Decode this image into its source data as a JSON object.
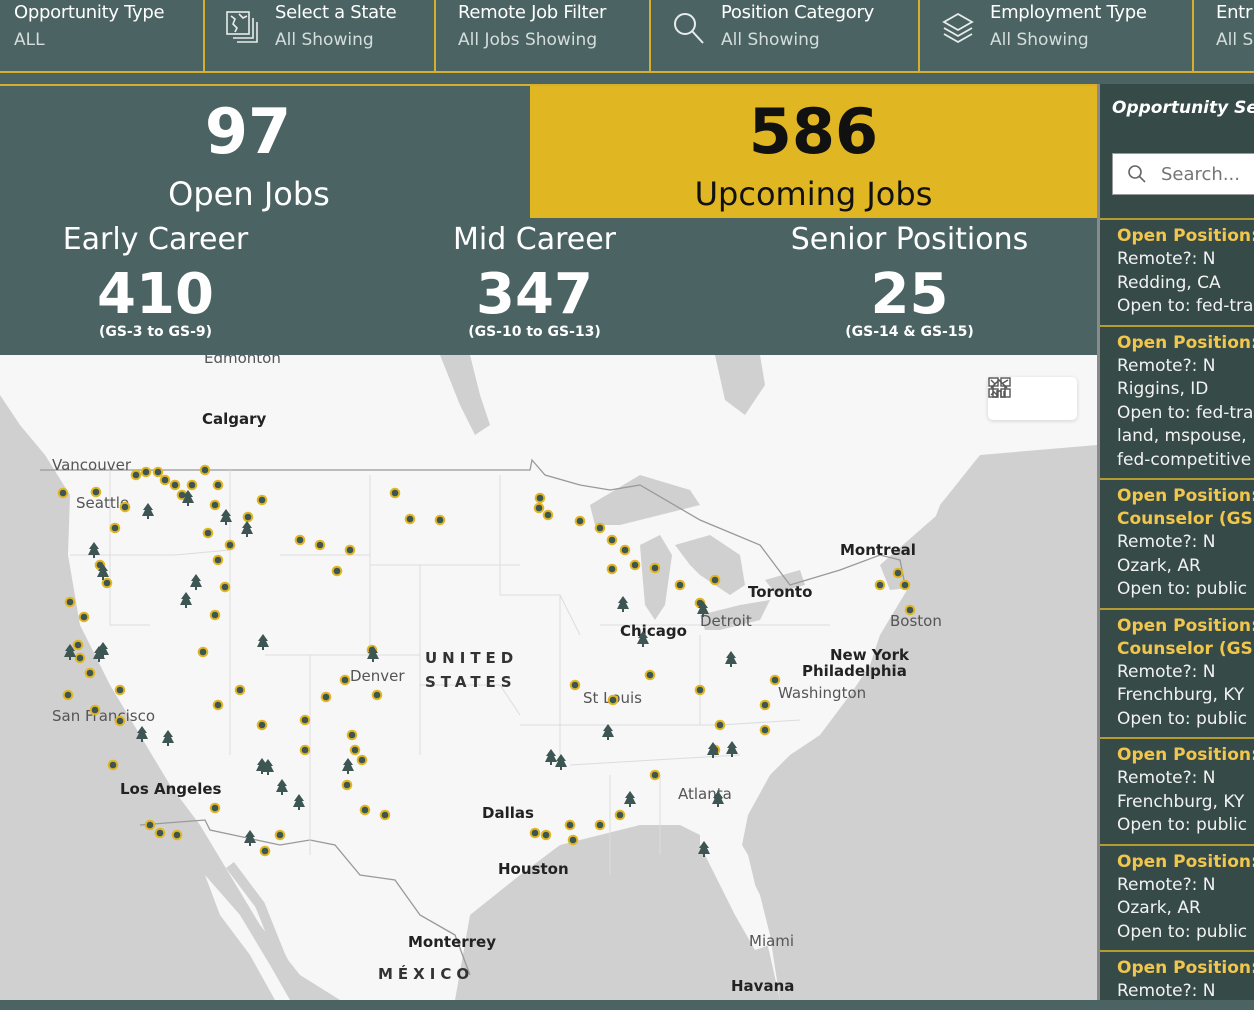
{
  "filters": [
    {
      "label": "Opportunity Type",
      "value": "ALL",
      "icon": "none"
    },
    {
      "label": "Select a State",
      "value": "All Showing",
      "icon": "map-layers-icon"
    },
    {
      "label": "Remote Job Filter",
      "value": "All Jobs Showing",
      "icon": "none"
    },
    {
      "label": "Position Category",
      "value": "All Showing",
      "icon": "search-icon"
    },
    {
      "label": "Employment Type",
      "value": "All Showing",
      "icon": "layers-icon"
    },
    {
      "label": "Entr",
      "value": "All S",
      "icon": "none"
    }
  ],
  "stats": {
    "open": {
      "value": "97",
      "label": "Open Jobs"
    },
    "upcoming": {
      "value": "586",
      "label": "Upcoming Jobs"
    },
    "early": {
      "title": "Early Career",
      "value": "410",
      "range": "(GS-3 to GS-9)"
    },
    "mid": {
      "title": "Mid Career",
      "value": "347",
      "range": "(GS-10 to GS-13)"
    },
    "senior": {
      "title": "Senior Positions",
      "value": "25",
      "range": "(GS-14 & GS-15)"
    }
  },
  "colors": {
    "panel": "#4b6463",
    "accent": "#d6b02d",
    "upcoming_bg": "#e0b623",
    "sidebar": "#364a48",
    "card_title": "#f1c64c"
  },
  "map": {
    "labels": [
      {
        "text": "Edmonton",
        "style": "gray"
      },
      {
        "text": "Calgary",
        "style": "bold"
      },
      {
        "text": "Vancouver",
        "style": "gray"
      },
      {
        "text": "Seattle",
        "style": "gray"
      },
      {
        "text": "San Francisco",
        "style": "gray"
      },
      {
        "text": "Los Angeles",
        "style": "bold"
      },
      {
        "text": "Denver",
        "style": "gray"
      },
      {
        "text": "UNITED",
        "style": "spaced"
      },
      {
        "text": "STATES",
        "style": "spaced"
      },
      {
        "text": "Dallas",
        "style": "bold"
      },
      {
        "text": "Houston",
        "style": "bold"
      },
      {
        "text": "Monterrey",
        "style": "bold"
      },
      {
        "text": "MÉXICO",
        "style": "spaced"
      },
      {
        "text": "Chicago",
        "style": "bold"
      },
      {
        "text": "Detroit",
        "style": "gray"
      },
      {
        "text": "Toronto",
        "style": "bold"
      },
      {
        "text": "Montreal",
        "style": "bold"
      },
      {
        "text": "Boston",
        "style": "gray"
      },
      {
        "text": "New York",
        "style": "bold"
      },
      {
        "text": "Philadelphia",
        "style": "bold"
      },
      {
        "text": "Washington",
        "style": "gray"
      },
      {
        "text": "St Louis",
        "style": "gray"
      },
      {
        "text": "Atlanta",
        "style": "gray"
      },
      {
        "text": "Miami",
        "style": "gray"
      },
      {
        "text": "Havana",
        "style": "bold"
      }
    ],
    "controls": {
      "home": "home-icon",
      "basemap": "basemap-gallery-icon"
    }
  },
  "sidebar": {
    "title": "Opportunity Sea",
    "search_placeholder": "Search...",
    "cards": [
      {
        "lines_title": [
          "Open Position:"
        ],
        "lines": [
          "Remote?: N",
          "Redding, CA",
          "Open to: fed-tra"
        ]
      },
      {
        "lines_title": [
          "Open Position:"
        ],
        "lines": [
          "Remote?: N",
          "Riggins, ID",
          "Open to: fed-tra",
          "land, mspouse,",
          "fed-competitive"
        ]
      },
      {
        "lines_title": [
          "Open Position:",
          "Counselor (GS:"
        ],
        "lines": [
          "Remote?: N",
          "Ozark, AR",
          "Open to: public"
        ]
      },
      {
        "lines_title": [
          "Open Position:",
          "Counselor (GS:"
        ],
        "lines": [
          "Remote?: N",
          "Frenchburg, KY",
          "Open to: public"
        ]
      },
      {
        "lines_title": [
          "Open Position:"
        ],
        "lines": [
          "Remote?: N",
          "Frenchburg, KY",
          "Open to: public"
        ]
      },
      {
        "lines_title": [
          "Open Position:"
        ],
        "lines": [
          "Remote?: N",
          "Ozark, AR",
          "Open to: public"
        ]
      },
      {
        "lines_title": [
          "Open Position:"
        ],
        "lines": [
          "Remote?: N"
        ]
      }
    ]
  }
}
